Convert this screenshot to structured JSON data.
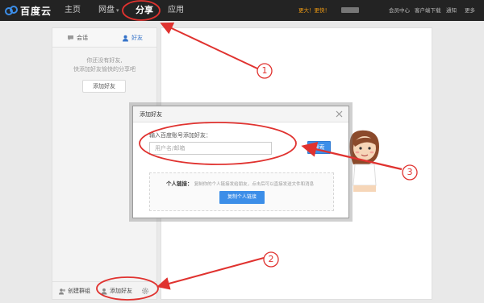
{
  "topbar": {
    "logo_text": "百度云",
    "nav": [
      {
        "label": "主页"
      },
      {
        "label": "网盘",
        "caret": "▾"
      },
      {
        "label": "分享"
      },
      {
        "label": "应用"
      }
    ],
    "vip_text": "更大！更快！",
    "right_links": [
      "会员中心",
      "客户端下载",
      "通知",
      "更多"
    ]
  },
  "sidebar": {
    "tabs": [
      {
        "label": "会话"
      },
      {
        "label": "好友"
      }
    ],
    "empty_line1": "你还没有好友,",
    "empty_line2": "快添加好友愉快的分享吧",
    "add_friend_button": "添加好友",
    "bottom": {
      "create_group": "创建群组",
      "add_friend": "添加好友"
    }
  },
  "dialog": {
    "title": "添加好友",
    "label": "输入百度账号添加好友：",
    "input_placeholder": "用户名/邮箱",
    "search_button": "搜索",
    "personal_link_title": "个人链接：",
    "personal_link_desc": "复制你的个人链接发给朋友，点击后可以直接发送文件和消息",
    "copy_button": "复制个人链接"
  },
  "annotations": {
    "labels": [
      "1",
      "2",
      "3"
    ],
    "color": "#e0322f"
  },
  "colors": {
    "accent": "#3c8ee8",
    "topbar": "#232323",
    "annotation": "#e0322f"
  }
}
